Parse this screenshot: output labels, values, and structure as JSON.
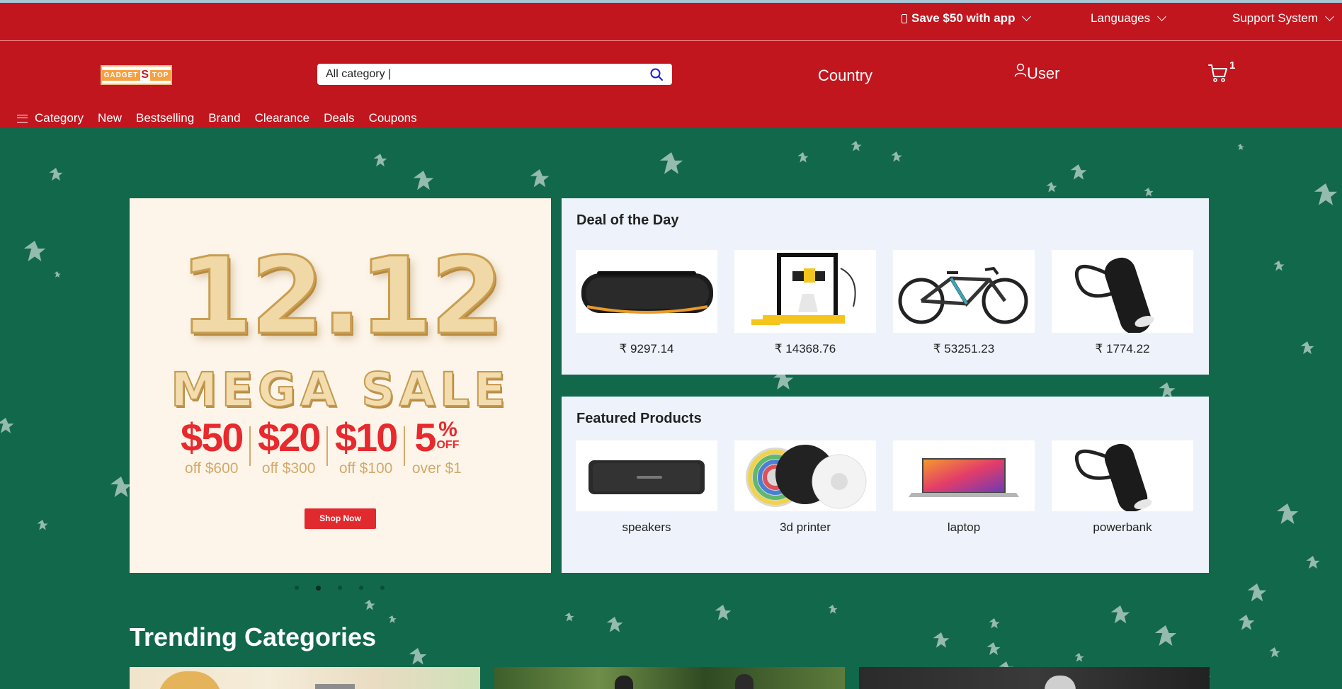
{
  "topbar": {
    "app_promo": "Save $50 with app",
    "languages": "Languages",
    "support": "Support System"
  },
  "header": {
    "logo_text": "GADGET STOP",
    "logo_parts": [
      "GADGET",
      "S",
      "TOP"
    ],
    "search": {
      "value": "All category |",
      "placeholder": ""
    },
    "country": "Country",
    "user": "User",
    "cart_count": "1"
  },
  "nav": {
    "items": [
      "Category",
      "New",
      "Bestselling",
      "Brand",
      "Clearance",
      "Deals",
      "Coupons"
    ]
  },
  "banner": {
    "headline": "12.12",
    "subheadline": "MEGA SALE",
    "offers": [
      {
        "amount": "$50",
        "condition": "off $600"
      },
      {
        "amount": "$20",
        "condition": "off $300"
      },
      {
        "amount": "$10",
        "condition": "off $100"
      },
      {
        "amount": "5",
        "percent": "%",
        "off": "OFF",
        "condition": "over $1"
      }
    ],
    "button": "Shop Now",
    "slide_count": 5,
    "active_slide": 2
  },
  "deal_of_day": {
    "title": "Deal of the Day",
    "items": [
      {
        "icon": "speaker-image",
        "price": "₹ 9297.14"
      },
      {
        "icon": "3d-printer-image",
        "price": "₹ 14368.76"
      },
      {
        "icon": "e-bike-image",
        "price": "₹ 53251.23"
      },
      {
        "icon": "powerbank-image",
        "price": "₹ 1774.22"
      }
    ]
  },
  "featured": {
    "title": "Featured Products",
    "items": [
      {
        "icon": "speaker-image",
        "label": "speakers"
      },
      {
        "icon": "filament-image",
        "label": "3d printer"
      },
      {
        "icon": "laptop-image",
        "label": "laptop"
      },
      {
        "icon": "powerbank-image",
        "label": "powerbank"
      }
    ]
  },
  "trending": {
    "title": "Trending Categories"
  },
  "colors": {
    "brand_red": "#c2161e",
    "background_green": "#12684a",
    "panel_bg": "#eef3fb",
    "sale_red": "#e8292d",
    "gold": "#d3a96b"
  }
}
